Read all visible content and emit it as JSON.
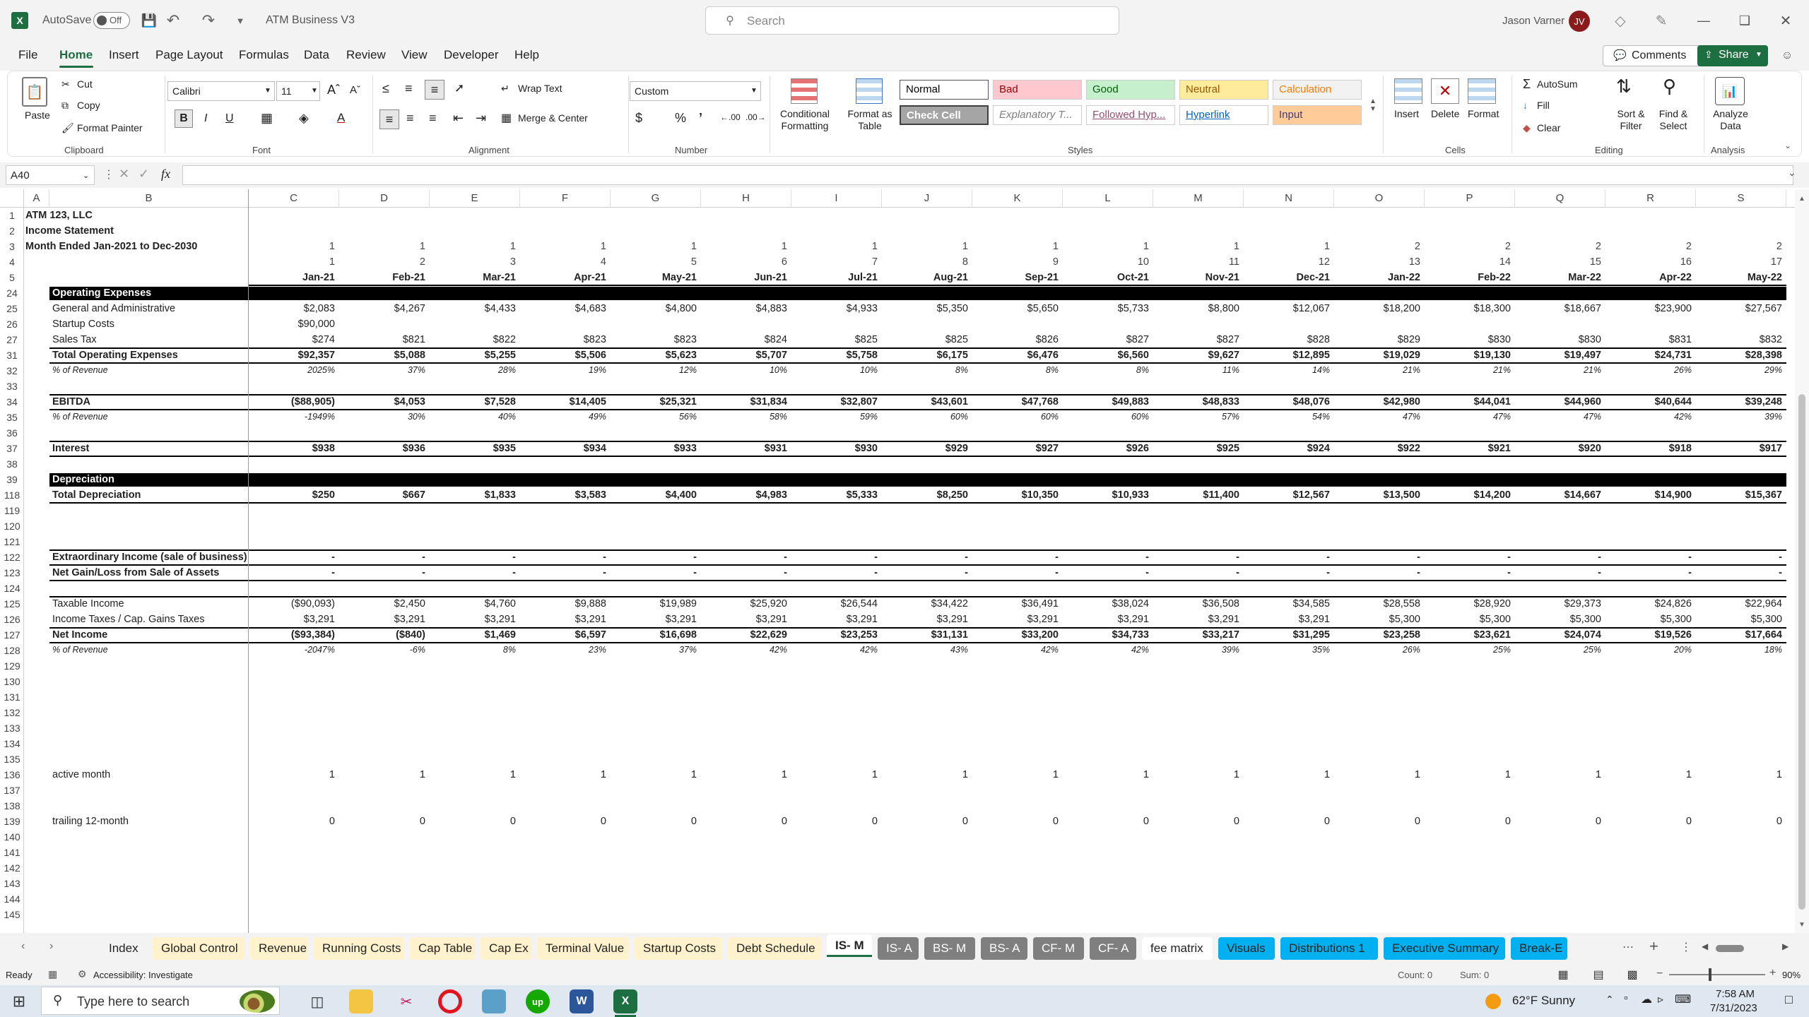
{
  "title_bar": {
    "autosave_label": "AutoSave",
    "autosave_state": "Off",
    "file_name": "ATM Business V3",
    "search_placeholder": "Search",
    "user_name": "Jason Varner",
    "user_initials": "JV"
  },
  "menu": [
    "File",
    "Home",
    "Insert",
    "Page Layout",
    "Formulas",
    "Data",
    "Review",
    "View",
    "Developer",
    "Help"
  ],
  "menu_active": "Home",
  "comments_label": "Comments",
  "share_label": "Share",
  "ribbon": {
    "clipboard": {
      "paste": "Paste",
      "cut": "Cut",
      "copy": "Copy",
      "format_painter": "Format Painter",
      "label": "Clipboard"
    },
    "font": {
      "name": "Calibri",
      "size": "11",
      "label": "Font"
    },
    "alignment": {
      "wrap": "Wrap Text",
      "merge": "Merge & Center",
      "label": "Alignment"
    },
    "number": {
      "format": "Custom",
      "label": "Number"
    },
    "styles": {
      "conditional": "Conditional Formatting",
      "format_table": "Format as Table",
      "label": "Styles",
      "cells": [
        {
          "name": "Normal",
          "bg": "#ffffff",
          "fg": "#000000"
        },
        {
          "name": "Bad",
          "bg": "#ffc7ce",
          "fg": "#9c0006"
        },
        {
          "name": "Good",
          "bg": "#c6efce",
          "fg": "#006100"
        },
        {
          "name": "Neutral",
          "bg": "#ffeb9c",
          "fg": "#9c5700"
        },
        {
          "name": "Calculation",
          "bg": "#f2f2f2",
          "fg": "#fa7d00"
        },
        {
          "name": "Check Cell",
          "bg": "#a5a5a5",
          "fg": "#ffffff"
        },
        {
          "name": "Explanatory T...",
          "bg": "#ffffff",
          "fg": "#7f7f7f"
        },
        {
          "name": "Followed Hyp...",
          "bg": "#ffffff",
          "fg": "#954f72"
        },
        {
          "name": "Hyperlink",
          "bg": "#ffffff",
          "fg": "#0563c1"
        },
        {
          "name": "Input",
          "bg": "#ffcc99",
          "fg": "#3f3f76"
        }
      ]
    },
    "cells_group": {
      "insert": "Insert",
      "delete": "Delete",
      "format": "Format",
      "label": "Cells"
    },
    "editing": {
      "autosum": "AutoSum",
      "fill": "Fill",
      "clear": "Clear",
      "sort": "Sort & Filter",
      "find": "Find & Select",
      "label": "Editing"
    },
    "analysis": {
      "analyze": "Analyze Data",
      "label": "Analysis"
    }
  },
  "formula_bar": {
    "name_box": "A40",
    "fx": "fx",
    "content": ""
  },
  "columns": [
    {
      "letter": "A",
      "w": 36
    },
    {
      "letter": "B",
      "w": 282
    },
    {
      "letter": "C",
      "w": 128
    },
    {
      "letter": "D",
      "w": 128
    },
    {
      "letter": "E",
      "w": 128
    },
    {
      "letter": "F",
      "w": 128
    },
    {
      "letter": "G",
      "w": 128
    },
    {
      "letter": "H",
      "w": 128
    },
    {
      "letter": "I",
      "w": 128
    },
    {
      "letter": "J",
      "w": 128
    },
    {
      "letter": "K",
      "w": 128
    },
    {
      "letter": "L",
      "w": 128
    },
    {
      "letter": "M",
      "w": 128
    },
    {
      "letter": "N",
      "w": 128
    },
    {
      "letter": "O",
      "w": 128
    },
    {
      "letter": "P",
      "w": 128
    },
    {
      "letter": "Q",
      "w": 128
    },
    {
      "letter": "R",
      "w": 128
    },
    {
      "letter": "S",
      "w": 128
    }
  ],
  "rows": [
    {
      "n": "1",
      "label": "ATM 123, LLC",
      "style": "bold",
      "vals": []
    },
    {
      "n": "2",
      "label": "Income Statement",
      "style": "bold",
      "vals": []
    },
    {
      "n": "3",
      "label": "Month Ended Jan-2021 to Dec-2030",
      "style": "bold",
      "vals": [
        "1",
        "1",
        "1",
        "1",
        "1",
        "1",
        "1",
        "1",
        "1",
        "1",
        "1",
        "1",
        "2",
        "2",
        "2",
        "2",
        "2"
      ]
    },
    {
      "n": "4",
      "label": "",
      "style": "small",
      "vals": [
        "1",
        "2",
        "3",
        "4",
        "5",
        "6",
        "7",
        "8",
        "9",
        "10",
        "11",
        "12",
        "13",
        "14",
        "15",
        "16",
        "17"
      ]
    },
    {
      "n": "5",
      "label": "",
      "style": "date",
      "vals": [
        "Jan-21",
        "Feb-21",
        "Mar-21",
        "Apr-21",
        "May-21",
        "Jun-21",
        "Jul-21",
        "Aug-21",
        "Sep-21",
        "Oct-21",
        "Nov-21",
        "Dec-21",
        "Jan-22",
        "Feb-22",
        "Mar-22",
        "Apr-22",
        "May-22"
      ]
    },
    {
      "n": "24",
      "label": "Operating Expenses",
      "style": "black",
      "vals": []
    },
    {
      "n": "25",
      "label": "General and Administrative",
      "style": "normal",
      "vals": [
        "$2,083",
        "$4,267",
        "$4,433",
        "$4,683",
        "$4,800",
        "$4,883",
        "$4,933",
        "$5,350",
        "$5,650",
        "$5,733",
        "$8,800",
        "$12,067",
        "$18,200",
        "$18,300",
        "$18,667",
        "$23,900",
        "$27,567"
      ]
    },
    {
      "n": "26",
      "label": "Startup Costs",
      "style": "normal",
      "vals": [
        "$90,000"
      ]
    },
    {
      "n": "27",
      "label": "Sales Tax",
      "style": "normal",
      "vals": [
        "$274",
        "$821",
        "$822",
        "$823",
        "$823",
        "$824",
        "$825",
        "$825",
        "$826",
        "$827",
        "$827",
        "$828",
        "$829",
        "$830",
        "$830",
        "$831",
        "$832"
      ]
    },
    {
      "n": "31",
      "label": "Total Operating Expenses",
      "style": "total",
      "vals": [
        "$92,357",
        "$5,088",
        "$5,255",
        "$5,506",
        "$5,623",
        "$5,707",
        "$5,758",
        "$6,175",
        "$6,476",
        "$6,560",
        "$9,627",
        "$12,895",
        "$19,029",
        "$19,130",
        "$19,497",
        "$24,731",
        "$28,398"
      ]
    },
    {
      "n": "32",
      "label": "% of Revenue",
      "style": "pct",
      "vals": [
        "2025%",
        "37%",
        "28%",
        "19%",
        "12%",
        "10%",
        "10%",
        "8%",
        "8%",
        "8%",
        "11%",
        "14%",
        "21%",
        "21%",
        "21%",
        "26%",
        "29%"
      ]
    },
    {
      "n": "33",
      "label": "",
      "style": "normal",
      "vals": []
    },
    {
      "n": "34",
      "label": "EBITDA",
      "style": "total",
      "vals": [
        "($88,905)",
        "$4,053",
        "$7,528",
        "$14,405",
        "$25,321",
        "$31,834",
        "$32,807",
        "$43,601",
        "$47,768",
        "$49,883",
        "$48,833",
        "$48,076",
        "$42,980",
        "$44,041",
        "$44,960",
        "$40,644",
        "$39,248"
      ]
    },
    {
      "n": "35",
      "label": "% of Revenue",
      "style": "pct",
      "vals": [
        "-1949%",
        "30%",
        "40%",
        "49%",
        "56%",
        "58%",
        "59%",
        "60%",
        "60%",
        "60%",
        "57%",
        "54%",
        "47%",
        "47%",
        "47%",
        "42%",
        "39%"
      ]
    },
    {
      "n": "36",
      "label": "",
      "style": "normal",
      "vals": []
    },
    {
      "n": "37",
      "label": "Interest",
      "style": "total",
      "vals": [
        "$938",
        "$936",
        "$935",
        "$934",
        "$933",
        "$931",
        "$930",
        "$929",
        "$927",
        "$926",
        "$925",
        "$924",
        "$922",
        "$921",
        "$920",
        "$918",
        "$917"
      ]
    },
    {
      "n": "38",
      "label": "",
      "style": "normal",
      "vals": []
    },
    {
      "n": "39",
      "label": "Depreciation",
      "style": "black",
      "vals": []
    },
    {
      "n": "118",
      "label": "Total Depreciation",
      "style": "boldline",
      "vals": [
        "$250",
        "$667",
        "$1,833",
        "$3,583",
        "$4,400",
        "$4,983",
        "$5,333",
        "$8,250",
        "$10,350",
        "$10,933",
        "$11,400",
        "$12,567",
        "$13,500",
        "$14,200",
        "$14,667",
        "$14,900",
        "$15,367"
      ]
    },
    {
      "n": "119",
      "label": "",
      "style": "normal",
      "vals": []
    },
    {
      "n": "120",
      "label": "",
      "style": "normal",
      "vals": []
    },
    {
      "n": "121",
      "label": "",
      "style": "normal",
      "vals": []
    },
    {
      "n": "122",
      "label": "Extraordinary Income (sale of business)",
      "style": "total",
      "vals": [
        "-",
        "-",
        "-",
        "-",
        "-",
        "-",
        "-",
        "-",
        "-",
        "-",
        "-",
        "-",
        "-",
        "-",
        "-",
        "-",
        "-"
      ]
    },
    {
      "n": "123",
      "label": "Net Gain/Loss from Sale of Assets",
      "style": "boldline",
      "vals": [
        "-",
        "-",
        "-",
        "-",
        "-",
        "-",
        "-",
        "-",
        "-",
        "-",
        "-",
        "-",
        "-",
        "-",
        "-",
        "-",
        "-"
      ]
    },
    {
      "n": "124",
      "label": "",
      "style": "normal",
      "vals": []
    },
    {
      "n": "125",
      "label": "Taxable Income",
      "style": "topline",
      "vals": [
        "($90,093)",
        "$2,450",
        "$4,760",
        "$9,888",
        "$19,989",
        "$25,920",
        "$26,544",
        "$34,422",
        "$36,491",
        "$38,024",
        "$36,508",
        "$34,585",
        "$28,558",
        "$28,920",
        "$29,373",
        "$24,826",
        "$22,964"
      ]
    },
    {
      "n": "126",
      "label": "Income Taxes / Cap. Gains Taxes",
      "style": "normal",
      "vals": [
        "$3,291",
        "$3,291",
        "$3,291",
        "$3,291",
        "$3,291",
        "$3,291",
        "$3,291",
        "$3,291",
        "$3,291",
        "$3,291",
        "$3,291",
        "$3,291",
        "$5,300",
        "$5,300",
        "$5,300",
        "$5,300",
        "$5,300"
      ]
    },
    {
      "n": "127",
      "label": "Net Income",
      "style": "total",
      "vals": [
        "($93,384)",
        "($840)",
        "$1,469",
        "$6,597",
        "$16,698",
        "$22,629",
        "$23,253",
        "$31,131",
        "$33,200",
        "$34,733",
        "$33,217",
        "$31,295",
        "$23,258",
        "$23,621",
        "$24,074",
        "$19,526",
        "$17,664"
      ]
    },
    {
      "n": "128",
      "label": "% of Revenue",
      "style": "pct",
      "vals": [
        "-2047%",
        "-6%",
        "8%",
        "23%",
        "37%",
        "42%",
        "42%",
        "43%",
        "42%",
        "42%",
        "39%",
        "35%",
        "26%",
        "25%",
        "25%",
        "20%",
        "18%"
      ]
    },
    {
      "n": "129",
      "label": "",
      "style": "normal",
      "vals": []
    },
    {
      "n": "130",
      "label": "",
      "style": "normal",
      "vals": []
    },
    {
      "n": "131",
      "label": "",
      "style": "normal",
      "vals": []
    },
    {
      "n": "132",
      "label": "",
      "style": "normal",
      "vals": []
    },
    {
      "n": "133",
      "label": "",
      "style": "normal",
      "vals": []
    },
    {
      "n": "134",
      "label": "",
      "style": "normal",
      "vals": []
    },
    {
      "n": "135",
      "label": "",
      "style": "normal",
      "vals": []
    },
    {
      "n": "136",
      "label": "active month",
      "style": "normal",
      "vals": [
        "1",
        "1",
        "1",
        "1",
        "1",
        "1",
        "1",
        "1",
        "1",
        "1",
        "1",
        "1",
        "1",
        "1",
        "1",
        "1",
        "1"
      ]
    },
    {
      "n": "137",
      "label": "",
      "style": "normal",
      "vals": []
    },
    {
      "n": "138",
      "label": "",
      "style": "normal",
      "vals": []
    },
    {
      "n": "139",
      "label": "trailing 12-month",
      "style": "normal",
      "vals": [
        "0",
        "0",
        "0",
        "0",
        "0",
        "0",
        "0",
        "0",
        "0",
        "0",
        "0",
        "0",
        "0",
        "0",
        "0",
        "0",
        "0"
      ]
    },
    {
      "n": "140",
      "label": "",
      "style": "normal",
      "vals": []
    },
    {
      "n": "141",
      "label": "",
      "style": "normal",
      "vals": []
    },
    {
      "n": "142",
      "label": "",
      "style": "normal",
      "vals": []
    },
    {
      "n": "143",
      "label": "",
      "style": "normal",
      "vals": []
    },
    {
      "n": "144",
      "label": "",
      "style": "normal",
      "vals": []
    },
    {
      "n": "145",
      "label": "",
      "style": "normal",
      "vals": []
    }
  ],
  "sheet_tabs": [
    {
      "name": "Index",
      "bg": "#f3f3f3",
      "fg": "#222"
    },
    {
      "name": "Global Control",
      "bg": "#fff2cc",
      "fg": "#222"
    },
    {
      "name": "Revenue",
      "bg": "#fff2cc",
      "fg": "#222"
    },
    {
      "name": "Running Costs",
      "bg": "#fff2cc",
      "fg": "#222"
    },
    {
      "name": "Cap Table",
      "bg": "#fff2cc",
      "fg": "#222"
    },
    {
      "name": "Cap Ex",
      "bg": "#fff2cc",
      "fg": "#222"
    },
    {
      "name": "Terminal Value",
      "bg": "#fff2cc",
      "fg": "#222"
    },
    {
      "name": "Startup Costs",
      "bg": "#fff2cc",
      "fg": "#222"
    },
    {
      "name": "Debt Schedule",
      "bg": "#fff2cc",
      "fg": "#222"
    },
    {
      "name": "IS- M",
      "bg": "#ffffff",
      "fg": "#222",
      "active": true
    },
    {
      "name": "IS- A",
      "bg": "#7f7f7f",
      "fg": "#ffffff"
    },
    {
      "name": "BS- M",
      "bg": "#7f7f7f",
      "fg": "#ffffff"
    },
    {
      "name": "BS- A",
      "bg": "#7f7f7f",
      "fg": "#ffffff"
    },
    {
      "name": "CF- M",
      "bg": "#7f7f7f",
      "fg": "#ffffff"
    },
    {
      "name": "CF- A",
      "bg": "#7f7f7f",
      "fg": "#ffffff"
    },
    {
      "name": "fee matrix",
      "bg": "#ffffff",
      "fg": "#222"
    },
    {
      "name": "Visuals",
      "bg": "#00b0f0",
      "fg": "#222"
    },
    {
      "name": "Distributions 1",
      "bg": "#00b0f0",
      "fg": "#222"
    },
    {
      "name": "Executive Summary",
      "bg": "#00b0f0",
      "fg": "#222"
    },
    {
      "name": "Break-E",
      "bg": "#00b0f0",
      "fg": "#222"
    }
  ],
  "status": {
    "ready": "Ready",
    "accessibility": "Accessibility: Investigate",
    "count": "Count: 0",
    "sum": "Sum: 0",
    "zoom": "90%"
  },
  "taskbar": {
    "search_placeholder": "Type here to search",
    "weather": "62°F  Sunny",
    "time": "7:58 AM",
    "date": "7/31/2023"
  }
}
